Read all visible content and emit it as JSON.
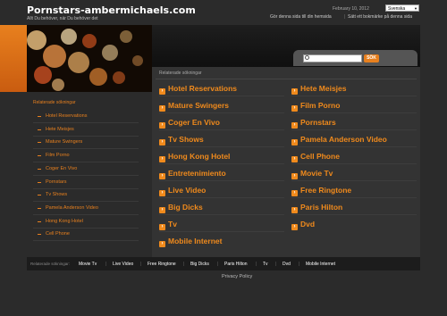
{
  "header": {
    "site_title": "Pornstars-ambermichaels.com",
    "tagline": "Allt Du behöver, när Du behöver det",
    "date": "February 10, 2012",
    "language": "Svenska",
    "link_homepage": "Gör denna sida till din hemsida",
    "link_bookmark": "Sätt ett bokmärke på denna sida"
  },
  "search": {
    "button": "SÖK"
  },
  "main": {
    "heading": "Relaterade sökningar",
    "col1": [
      "Hotel Reservations",
      "Mature Swingers",
      "Coger En Vivo",
      "Tv Shows",
      "Hong Kong Hotel",
      "Entretenimiento",
      "Live Video",
      "Big Dicks",
      "Tv",
      "Mobile Internet"
    ],
    "col2": [
      "Hete Meisjes",
      "Film Porno",
      "Pornstars",
      "Pamela Anderson Video",
      "Cell Phone",
      "Movie Tv",
      "Free Ringtone",
      "Paris Hilton",
      "Dvd"
    ]
  },
  "sidebar": {
    "heading": "Relaterade sökningar",
    "items": [
      "Hotel Reservations",
      "Hete Meisjes",
      "Mature Swingers",
      "Film Porno",
      "Coger En Vivo",
      "Pornstars",
      "Tv Shows",
      "Pamela Anderson Video",
      "Hong Kong Hotel",
      "Cell Phone"
    ]
  },
  "footer": {
    "label": "Relaterade sökningar:",
    "links": [
      "Movie Tv",
      "Live Video",
      "Free Ringtone",
      "Big Dicks",
      "Paris Hilton",
      "Tv",
      "Dvd",
      "Mobile Internet"
    ],
    "privacy": "Privacy Policy"
  },
  "colors": {
    "accent": "#f08a1c",
    "background": "#2b2b2b"
  }
}
